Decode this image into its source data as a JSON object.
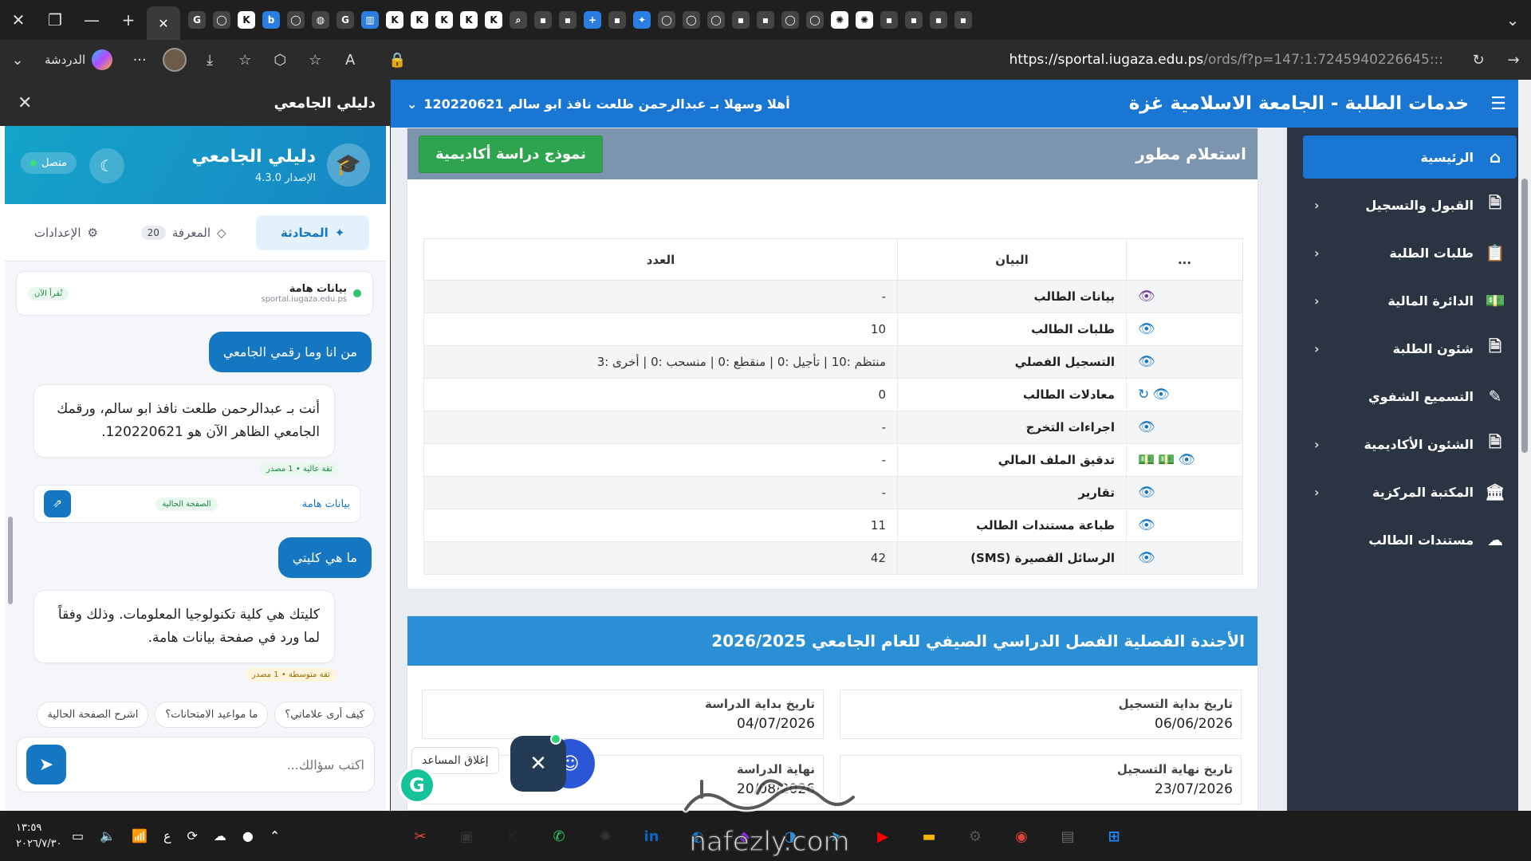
{
  "browser": {
    "tab_icons": [
      "google-icon",
      "github-icon",
      "k-icon",
      "bing-icon",
      "github-icon",
      "globe-icon",
      "google-icon",
      "chart-icon",
      "k-icon",
      "k-icon",
      "k-icon",
      "k-icon",
      "k-icon",
      "search-icon",
      "app-icon",
      "app-icon",
      "plus-icon",
      "app-icon",
      "gemini-icon",
      "github-icon",
      "github-icon",
      "github-icon",
      "app-icon",
      "app-icon",
      "github-icon",
      "github-icon",
      "chatgpt-icon",
      "chatgpt-icon",
      "app-icon",
      "app-icon",
      "app-icon",
      "app-icon"
    ],
    "copilot_label": "الدردشة",
    "url_host": "https://sportal.iugaza.edu.ps",
    "url_path": "/ords/f?p=147:1:7245940226645:::"
  },
  "assistant": {
    "panel_title": "دليلي الجامعي",
    "name": "دليلي الجامعي",
    "version": "الإصدار 4.3.0",
    "status": "متصل",
    "tabs": [
      {
        "label": "المحادثة",
        "icon": "sparkle-icon"
      },
      {
        "label": "المعرفة",
        "badge": "20"
      },
      {
        "label": "الإعدادات",
        "icon": "gear-icon"
      }
    ],
    "context_card": {
      "title": "بيانات هامة",
      "source": "sportal.iugaza.edu.ps",
      "status": "تُقرأ الآن"
    },
    "messages": [
      {
        "role": "user",
        "text": "من انا وما رقمي الجامعي"
      },
      {
        "role": "bot",
        "text": "أنت بـ عبدالرحمن طلعت نافذ ابو سالم، ورقمك الجامعي الظاهر الآن هو 120220621."
      },
      {
        "role": "bot_confidence",
        "text": "ثقة عالية • 1 مصدر"
      },
      {
        "role": "source",
        "label": "بيانات هامة",
        "tag": "الصفحة الحالية"
      },
      {
        "role": "user",
        "text": "ما هي كليتي"
      },
      {
        "role": "bot",
        "text": "كليتك هي كلية تكنولوجيا المعلومات. وذلك وفقاً لما ورد في صفحة بيانات هامة."
      },
      {
        "role": "bot_confidence",
        "text": "ثقة متوسطة • 1 مصدر"
      }
    ],
    "suggestions": [
      "كيف أرى علاماتي؟",
      "ما مواعيد الامتحانات؟",
      "اشرح الصفحة الحالية"
    ],
    "input_placeholder": "اكتب سؤالك..."
  },
  "site": {
    "brand": "خدمات الطلبة - الجامعة الاسلامية غزة",
    "welcome": "أهلا وسهلا بـ عبدالرحمن طلعت نافذ ابو سالم 120220621",
    "nav": [
      {
        "label": "الرئيسية",
        "icon": "home-icon",
        "active": true
      },
      {
        "label": "القبول والتسجيل",
        "icon": "document-icon"
      },
      {
        "label": "طلبات الطلبة",
        "icon": "clipboard-icon"
      },
      {
        "label": "الدائرة المالية",
        "icon": "money-icon"
      },
      {
        "label": "شئون الطلبة",
        "icon": "document-icon"
      },
      {
        "label": "التسميع الشفوي",
        "icon": "brain-icon"
      },
      {
        "label": "الشئون الأكاديمية",
        "icon": "document-icon"
      },
      {
        "label": "المكتبة المركزية",
        "icon": "building-icon"
      },
      {
        "label": "مستندات الطالب",
        "icon": "cloud-upload-icon"
      }
    ],
    "inquiry": {
      "title": "استعلام مطور",
      "button": "نموذج دراسة أكاديمية",
      "headers": [
        "...",
        "البيان",
        "العدد"
      ],
      "rows": [
        {
          "label": "بيانات الطالب",
          "value": "-",
          "icons": "eye-purple"
        },
        {
          "label": "طلبات الطالب",
          "value": "10",
          "icons": "eye"
        },
        {
          "label": "التسجيل الفصلي",
          "value": "منتظم :10 | تأجيل :0 | منقطع :0 | منسحب :0 | أخرى :3",
          "icons": "eye"
        },
        {
          "label": "معادلات الطالب",
          "value": "0",
          "icons": "eye-refresh"
        },
        {
          "label": "اجراءات التخرج",
          "value": "-",
          "icons": "eye"
        },
        {
          "label": "تدقيق الملف المالي",
          "value": "-",
          "icons": "eye-money"
        },
        {
          "label": "تقارير",
          "value": "-",
          "icons": "eye"
        },
        {
          "label": "طباعة مستندات الطالب",
          "value": "11",
          "icons": "eye"
        },
        {
          "label": "الرسائل القصيرة (SMS)",
          "value": "42",
          "icons": "eye"
        }
      ]
    },
    "agenda": {
      "title": "الأجندة الفصلية الفصل الدراسي الصيفي للعام الجامعي 2026/2025",
      "items": [
        {
          "label": "تاريخ بداية التسجيل",
          "value": "06/06/2026"
        },
        {
          "label": "تاريخ بداية الدراسة",
          "value": "04/07/2026"
        },
        {
          "label": "تاريخ نهاية التسجيل",
          "value": "23/07/2026"
        },
        {
          "label": "نهاية الدراسة",
          "value": "20/08/2026"
        }
      ]
    },
    "close_assistant": "إغلاق المساعد"
  },
  "taskbar": {
    "time": "١٣:٥٩",
    "date": "٢٠٢٦/٧/٣٠",
    "lang": "ع"
  },
  "watermark": {
    "line1": "مستقل",
    "line2": "nafezly.com"
  },
  "colors": {
    "primary": "#1976d2",
    "sidebar": "#2b3442",
    "green": "#2ea44f",
    "header_gray": "#7c94ae"
  }
}
